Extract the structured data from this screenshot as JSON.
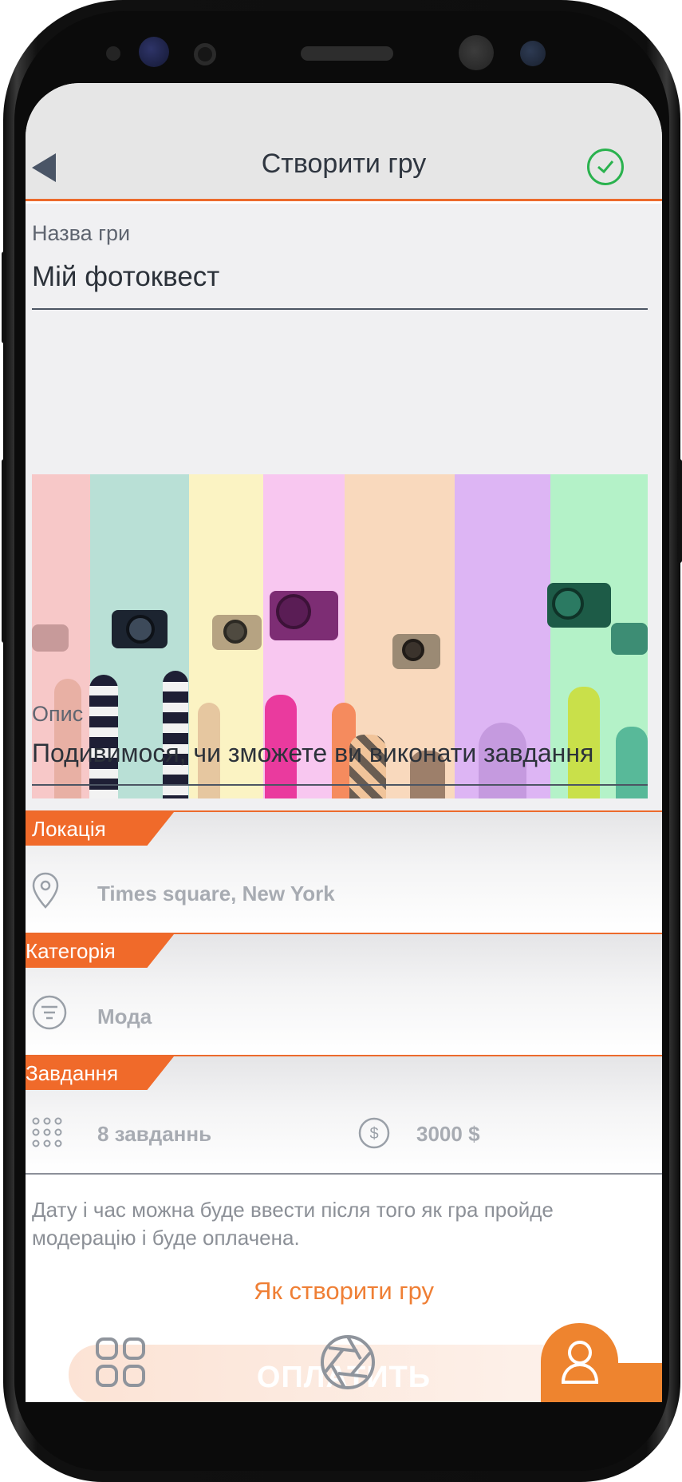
{
  "header": {
    "title": "Створити гру",
    "back_icon": "back-arrow-icon",
    "confirm_icon": "check-circle-icon"
  },
  "game_name": {
    "label": "Назва гри",
    "value": "Мій фотоквест"
  },
  "description": {
    "label": "Опис",
    "value": "Подивимося, чи зможете ви виконати завдання"
  },
  "location": {
    "tag": "Локація",
    "icon": "location-pin-icon",
    "value": "Times square, New York"
  },
  "category": {
    "tag": "Категорія",
    "icon": "list-circle-icon",
    "value": "Мода"
  },
  "tasks": {
    "tag": "Завдання",
    "count_icon": "grid-dots-icon",
    "count": "8 завданнь",
    "price_icon": "dollar-circle-icon",
    "price": "3000 $"
  },
  "note": "Дату і час можна буде ввести після того як гра пройде модерацію і буде оплачена.",
  "how_to_link": "Як створити гру",
  "pay_button": "ОПЛАТИТЬ",
  "colors": {
    "accent": "#ec6a2c",
    "success": "#2ab24e",
    "profile_tab": "#ee842f"
  },
  "nav": {
    "grid_icon": "apps-grid-icon",
    "lens_icon": "camera-aperture-icon",
    "profile_icon": "user-profile-icon"
  }
}
